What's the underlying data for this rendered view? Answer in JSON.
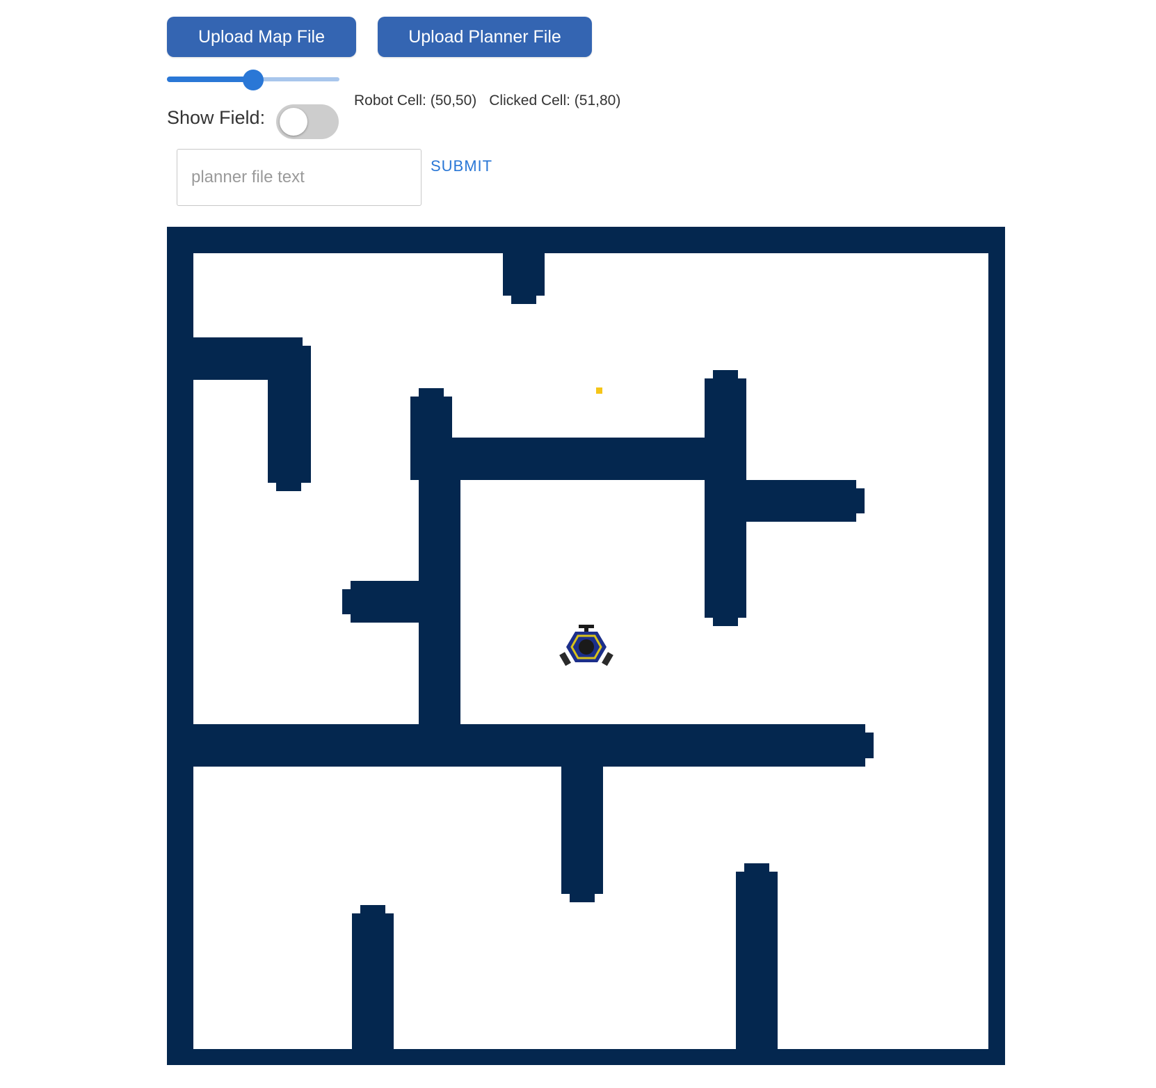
{
  "toolbar": {
    "upload_map_label": "Upload Map File",
    "upload_planner_label": "Upload Planner File"
  },
  "slider": {
    "fraction": 0.5
  },
  "show_field": {
    "label": "Show Field:",
    "enabled": false
  },
  "status": {
    "robot_cell": "Robot Cell: (50,50)",
    "clicked_cell": "Clicked Cell: (51,80)"
  },
  "planner": {
    "placeholder": "planner file text",
    "value": "",
    "submit_label": "SUBMIT"
  },
  "map": {
    "wall_color": "#04274f",
    "free_color": "#ffffff",
    "goal_marker_color": "#f5c518",
    "robot_icon": "robot-icon",
    "robot_colors": {
      "body": "#1c2f8a",
      "ring": "#d8c21a",
      "dark": "#1a1a1a"
    }
  }
}
